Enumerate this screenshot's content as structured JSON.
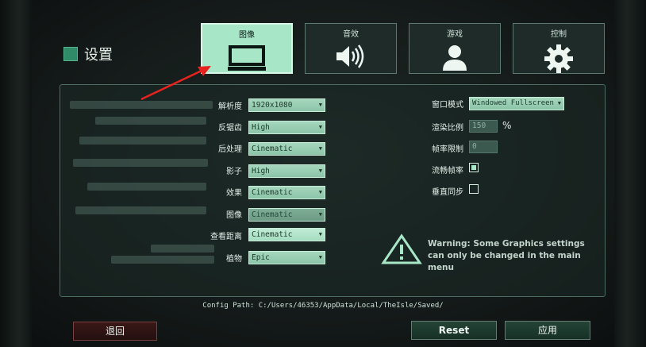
{
  "title": "设置",
  "tabs": [
    {
      "label": "图像",
      "icon": "monitor-icon",
      "active": true
    },
    {
      "label": "音效",
      "icon": "speaker-icon",
      "active": false
    },
    {
      "label": "游戏",
      "icon": "user-icon",
      "active": false
    },
    {
      "label": "控制",
      "icon": "gear-icon",
      "active": false
    }
  ],
  "left_settings": [
    {
      "label": "解析度",
      "value": "1920x1080"
    },
    {
      "label": "反锯齿",
      "value": "High"
    },
    {
      "label": "后处理",
      "value": "Cinematic"
    },
    {
      "label": "影子",
      "value": "High"
    },
    {
      "label": "效果",
      "value": "Cinematic"
    },
    {
      "label": "图像",
      "value": "Cinematic"
    },
    {
      "label": "查看距离",
      "value": "Cinematic"
    },
    {
      "label": "植物",
      "value": "Epic"
    }
  ],
  "right_settings": {
    "window_mode": {
      "label": "窗口模式",
      "value": "Windowed Fullscreen"
    },
    "render_scale": {
      "label": "渲染比例",
      "value": "150",
      "unit": "%"
    },
    "frame_limit": {
      "label": "帧率限制",
      "value": "0"
    },
    "smooth_framerate": {
      "label": "流畅帧率",
      "checked": true
    },
    "vsync": {
      "label": "垂直同步",
      "checked": false
    }
  },
  "warning": "Warning: Some Graphics settings can only be changed in the main menu",
  "config_path": "Config Path: C:/Users/46353/AppData/Local/TheIsle/Saved/",
  "buttons": {
    "back": "退回",
    "reset": "Reset",
    "apply": "应用"
  },
  "colors": {
    "accent": "#a8e6c8",
    "panel_border": "#4c6b61",
    "annotation_arrow": "#e8231f"
  }
}
